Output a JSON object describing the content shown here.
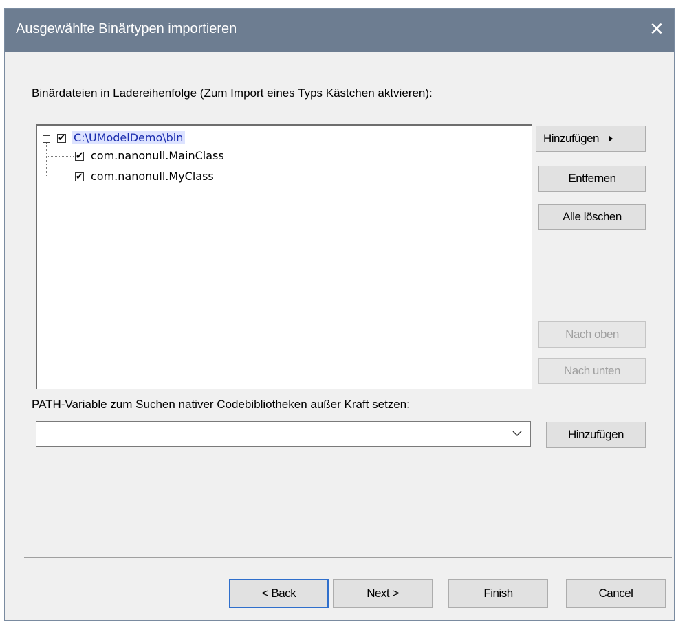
{
  "window": {
    "title": "Ausgewählte Binärtypen importieren",
    "close_icon": "close-icon"
  },
  "binaries": {
    "label": "Binärdateien in Ladereihenfolge (Zum Import eines Typs Kästchen aktvieren):",
    "tree": {
      "root": {
        "label": "C:\\UModelDemo\\bin",
        "checked": true,
        "expanded": true,
        "selected": true
      },
      "children": [
        {
          "label": "com.nanonull.MainClass",
          "checked": true
        },
        {
          "label": "com.nanonull.MyClass",
          "checked": true
        }
      ]
    },
    "buttons": {
      "add": "Hinzufügen",
      "remove": "Entfernen",
      "clear_all": "Alle löschen",
      "move_up": "Nach oben",
      "move_down": "Nach unten"
    }
  },
  "path_override": {
    "label": "PATH-Variable zum Suchen nativer Codebibliotheken außer Kraft setzen:",
    "value": "",
    "add_button": "Hinzufügen"
  },
  "footer": {
    "back": "< Back",
    "next": "Next >",
    "finish": "Finish",
    "cancel": "Cancel"
  },
  "colors": {
    "titlebar": "#6d7d91",
    "selection": "#dde3ff",
    "default_button_border": "#2f6fcc"
  }
}
